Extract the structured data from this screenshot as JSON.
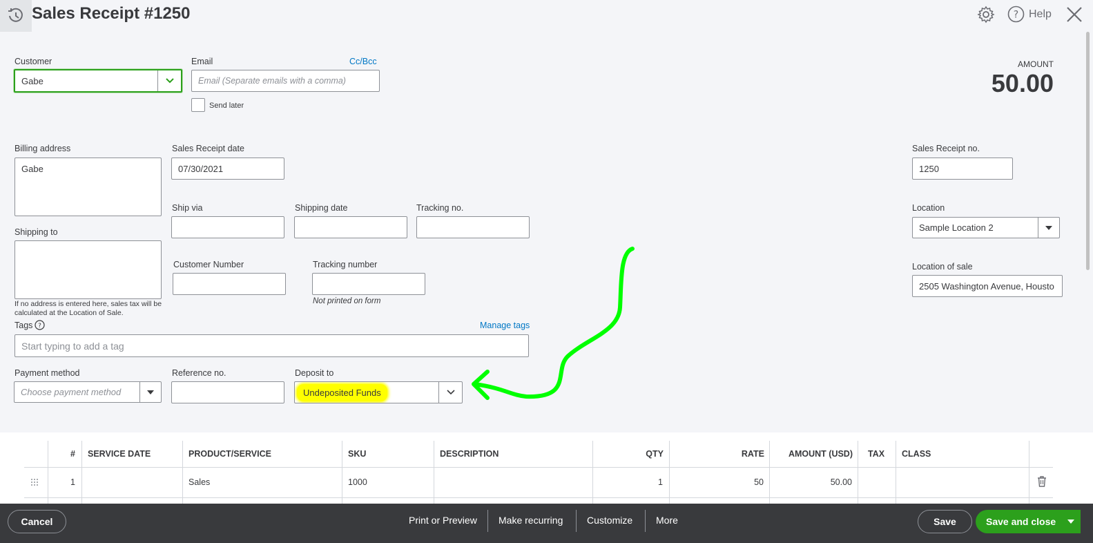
{
  "header": {
    "title": "Sales Receipt #1250",
    "help_label": "Help"
  },
  "customer": {
    "label": "Customer",
    "value": "Gabe"
  },
  "email": {
    "label": "Email",
    "cc_bcc": "Cc/Bcc",
    "placeholder": "Email (Separate emails with a comma)",
    "send_later": "Send later"
  },
  "amount": {
    "label": "AMOUNT",
    "value": "50.00"
  },
  "billing": {
    "label": "Billing address",
    "value": "Gabe"
  },
  "receipt_date": {
    "label": "Sales Receipt date",
    "value": "07/30/2021"
  },
  "receipt_no": {
    "label": "Sales Receipt no.",
    "value": "1250"
  },
  "ship_via": {
    "label": "Ship via"
  },
  "shipping_date": {
    "label": "Shipping date"
  },
  "tracking_no": {
    "label": "Tracking no."
  },
  "location": {
    "label": "Location",
    "value": "Sample Location 2"
  },
  "shipping_to": {
    "label": "Shipping to",
    "note_line1": "If no address is entered here, sales tax will be",
    "note_line2": "calculated at the Location of Sale."
  },
  "customer_number": {
    "label": "Customer Number"
  },
  "tracking_number": {
    "label": "Tracking number",
    "note": "Not printed on form"
  },
  "location_of_sale": {
    "label": "Location of sale",
    "value": "2505 Washington Avenue, Housto"
  },
  "tags": {
    "label": "Tags",
    "manage": "Manage tags",
    "placeholder": "Start typing to add a tag"
  },
  "payment_method": {
    "label": "Payment method",
    "placeholder": "Choose payment method"
  },
  "reference_no": {
    "label": "Reference no."
  },
  "deposit_to": {
    "label": "Deposit to",
    "value": "Undeposited Funds"
  },
  "table": {
    "headers": {
      "num": "#",
      "service_date": "SERVICE DATE",
      "product": "PRODUCT/SERVICE",
      "sku": "SKU",
      "description": "DESCRIPTION",
      "qty": "QTY",
      "rate": "RATE",
      "amount": "AMOUNT (USD)",
      "tax": "TAX",
      "class": "CLASS"
    },
    "rows": [
      {
        "num": "1",
        "service_date": "",
        "product": "Sales",
        "sku": "1000",
        "description": "",
        "qty": "1",
        "rate": "50",
        "amount": "50.00",
        "tax": "",
        "class": ""
      }
    ]
  },
  "footer": {
    "cancel": "Cancel",
    "print_preview": "Print or Preview",
    "make_recurring": "Make recurring",
    "customize": "Customize",
    "more": "More",
    "save": "Save",
    "save_close": "Save and close"
  },
  "colors": {
    "accent_green": "#2ca01c",
    "link_blue": "#0077c5",
    "footer_bg": "#393a3d",
    "highlight_yellow": "#ffff00",
    "annotation_green": "#00ff00"
  },
  "icons": [
    "recent-transactions-icon",
    "gear-icon",
    "help-circle-icon",
    "close-icon",
    "chevron-down-icon",
    "dropdown-caret-icon",
    "drag-handle-icon",
    "trash-icon"
  ]
}
